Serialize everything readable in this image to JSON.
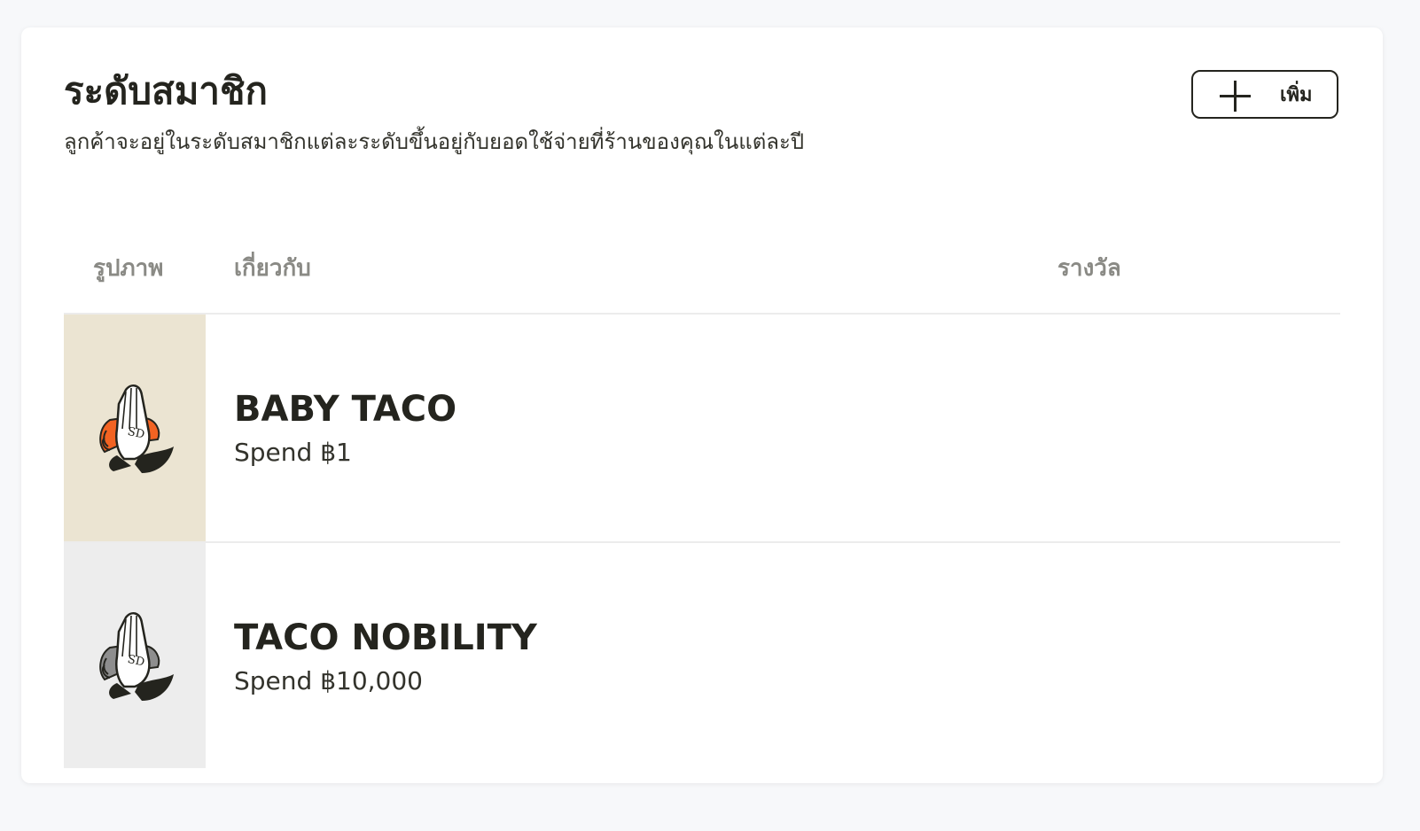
{
  "header": {
    "title": "ระดับสมาชิก",
    "subtitle": "ลูกค้าจะอยู่ในระดับสมาชิกแต่ละระดับขึ้นอยู่กับยอดใช้จ่ายที่ร้านของคุณในแต่ละปี",
    "add_button_label": "เพิ่ม",
    "add_button_icon": "plus-icon"
  },
  "table": {
    "columns": [
      "รูปภาพ",
      "เกี่ยวกับ",
      "รางวัล"
    ],
    "rows": [
      {
        "name": "BABY TACO",
        "spend": "Spend ฿1",
        "reward": "",
        "image_icon": "praying-hands-taco-icon",
        "thumb_bg": "#ebe4d2",
        "taco_color": "#f26322"
      },
      {
        "name": "TACO NOBILITY",
        "spend": "Spend ฿10,000",
        "reward": "",
        "image_icon": "praying-hands-taco-icon",
        "thumb_bg": "#ededed",
        "taco_color": "#8e8e8e"
      }
    ]
  },
  "colors": {
    "page_bg": "#f7f8fa",
    "card_bg": "#ffffff",
    "text": "#24241e",
    "muted_header": "#8a8a85",
    "divider": "#ececec"
  }
}
